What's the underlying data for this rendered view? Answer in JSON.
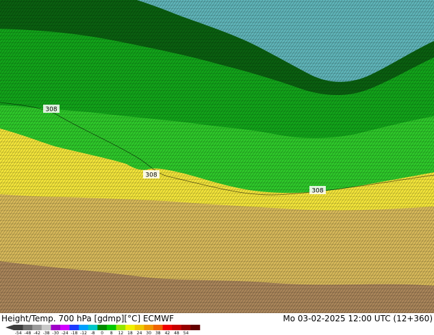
{
  "footer": {
    "title_left": "Height/Temp. 700 hPa [gdmp][°C] ECMWF",
    "title_right": "Mo 03-02-2025 12:00 UTC (12+360)"
  },
  "map": {
    "contour_labels": [
      "308",
      "308",
      "308"
    ],
    "colors": {
      "teal": "#5fb4b8",
      "dark_green": "#0a6010",
      "green": "#12a41a",
      "light_green": "#2ec82a",
      "yellow": "#f2e43a",
      "tan": "#d6b85a",
      "brown": "#a9855a"
    }
  },
  "legend": {
    "ticks": [
      "-54",
      "-48",
      "-42",
      "-38",
      "-30",
      "-24",
      "-18",
      "-12",
      "-8",
      "0",
      "8",
      "12",
      "18",
      "24",
      "30",
      "38",
      "42",
      "48",
      "54"
    ],
    "colors": [
      "#3c3c3c",
      "#6e6e6e",
      "#9a9a9a",
      "#c8c8c8",
      "#a000c8",
      "#d200ff",
      "#1e3cff",
      "#00a0ff",
      "#00c8c8",
      "#008c00",
      "#00c800",
      "#96e600",
      "#f0f000",
      "#f0c800",
      "#f09600",
      "#f06400",
      "#f00000",
      "#c80000",
      "#960000",
      "#640000"
    ]
  }
}
